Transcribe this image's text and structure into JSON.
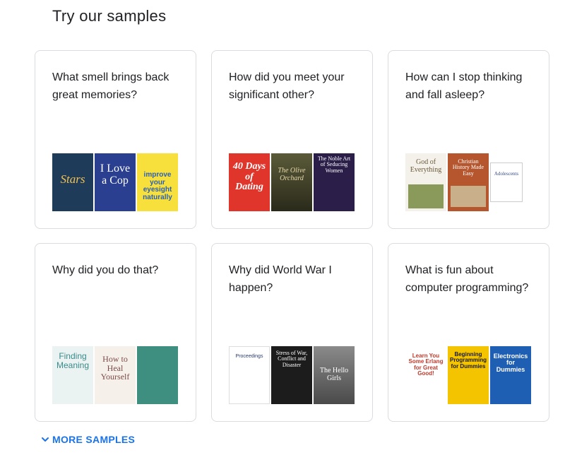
{
  "heading": "Try our samples",
  "cards": [
    {
      "question": "What smell brings back great memories?",
      "books": [
        {
          "title": "Stars",
          "bg": "#1f3b5a",
          "fg": "#f2c14e"
        },
        {
          "title": "I Love a Cop",
          "bg": "#2a3f8f",
          "fg": "#ffffff"
        },
        {
          "title": "improve your eyesight naturally",
          "bg": "#f7e03c",
          "fg": "#2b5fb3"
        }
      ]
    },
    {
      "question": "How did you meet your significant other?",
      "books": [
        {
          "title": "40 Days of Dating",
          "bg": "#e0352b",
          "fg": "#ffffff"
        },
        {
          "title": "The Olive Orchard",
          "bg": "#3a3a2a",
          "fg": "#e8d9a8"
        },
        {
          "title": "The Noble Art of Seducing Women",
          "bg": "#2b1f4a",
          "fg": "#ffffff"
        }
      ]
    },
    {
      "question": "How can I stop thinking and fall asleep?",
      "books": [
        {
          "title": "God of Everything",
          "bg": "#f4f1ea",
          "fg": "#6b5a3a"
        },
        {
          "title": "Christian History Made Easy",
          "bg": "#b5562e",
          "fg": "#ffffff"
        },
        {
          "title": "Adolescents",
          "bg": "#ffffff",
          "fg": "#3a4a8a"
        }
      ]
    },
    {
      "question": "Why did you do that?",
      "books": [
        {
          "title": "Finding Meaning",
          "bg": "#eaf3f2",
          "fg": "#3a8a8a"
        },
        {
          "title": "How to Heal Yourself",
          "bg": "#f6f0ea",
          "fg": "#7a4a4a"
        },
        {
          "title": "",
          "bg": "#3f8f80",
          "fg": "#e8f5ee"
        }
      ]
    },
    {
      "question": "Why did World War I happen?",
      "books": [
        {
          "title": "Proceedings",
          "bg": "#ffffff",
          "fg": "#2a3a6a"
        },
        {
          "title": "Stress of War, Conflict and Disaster",
          "bg": "#1c1c1c",
          "fg": "#ffffff"
        },
        {
          "title": "The Hello Girls",
          "bg": "#6a6a6a",
          "fg": "#ffffff"
        }
      ]
    },
    {
      "question": "What is fun about computer programming?",
      "books": [
        {
          "title": "Learn You Some Erlang for Great Good!",
          "bg": "#ffffff",
          "fg": "#c0392b"
        },
        {
          "title": "Beginning Programming for Dummies",
          "bg": "#f5c400",
          "fg": "#1a1a1a"
        },
        {
          "title": "Electronics for Dummies",
          "bg": "#1f5fb3",
          "fg": "#ffffff"
        }
      ]
    }
  ],
  "more_label": "MORE SAMPLES",
  "colors": {
    "link": "#1a73e8",
    "border": "#dadce0"
  }
}
